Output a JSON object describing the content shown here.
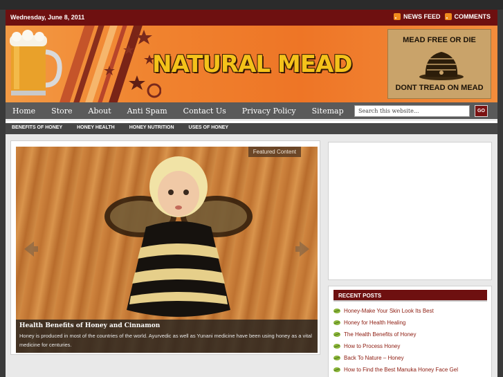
{
  "topbar": {
    "date": "Wednesday, June 8, 2011",
    "news_feed": "NEWS FEED",
    "comments": "COMMENTS"
  },
  "header": {
    "site_title": "NATURAL MEAD",
    "flag_top": "MEAD FREE OR DIE",
    "flag_bottom": "DONT TREAD ON MEAD"
  },
  "nav": {
    "items": [
      {
        "label": "Home"
      },
      {
        "label": "Store"
      },
      {
        "label": "About"
      },
      {
        "label": "Anti Spam"
      },
      {
        "label": "Contact Us"
      },
      {
        "label": "Privacy Policy"
      },
      {
        "label": "Sitemap"
      }
    ],
    "search_placeholder": "Search this website...",
    "go_label": "GO"
  },
  "subnav": {
    "items": [
      {
        "label": "BENEFITS OF HONEY"
      },
      {
        "label": "HONEY HEALTH"
      },
      {
        "label": "HONEY NUTRITION"
      },
      {
        "label": "USES OF HONEY"
      }
    ]
  },
  "slider": {
    "badge": "Featured Content",
    "title": "Health Benefits of Honey and Cinnamon",
    "text": "Honey is produced in most of the countries of the world. Ayurvedic as well as Yunani medicine have been using honey as a vital medicine for centuries."
  },
  "sidebar": {
    "recent_title": "RECENT POSTS",
    "recent_posts": [
      {
        "label": "Honey-Make Your Skin Look Its Best"
      },
      {
        "label": "Honey for Health Healing"
      },
      {
        "label": "The Health Benefits of Honey"
      },
      {
        "label": "How to Process Honey"
      },
      {
        "label": "Back To Nature – Honey"
      },
      {
        "label": "How to Find the Best Manuka Honey Face Gel"
      }
    ]
  },
  "colors": {
    "maroon": "#6e1010",
    "header_orange": "#f0832f",
    "nav_gray": "#5a5a5a",
    "link_red": "#8c1a0e"
  }
}
